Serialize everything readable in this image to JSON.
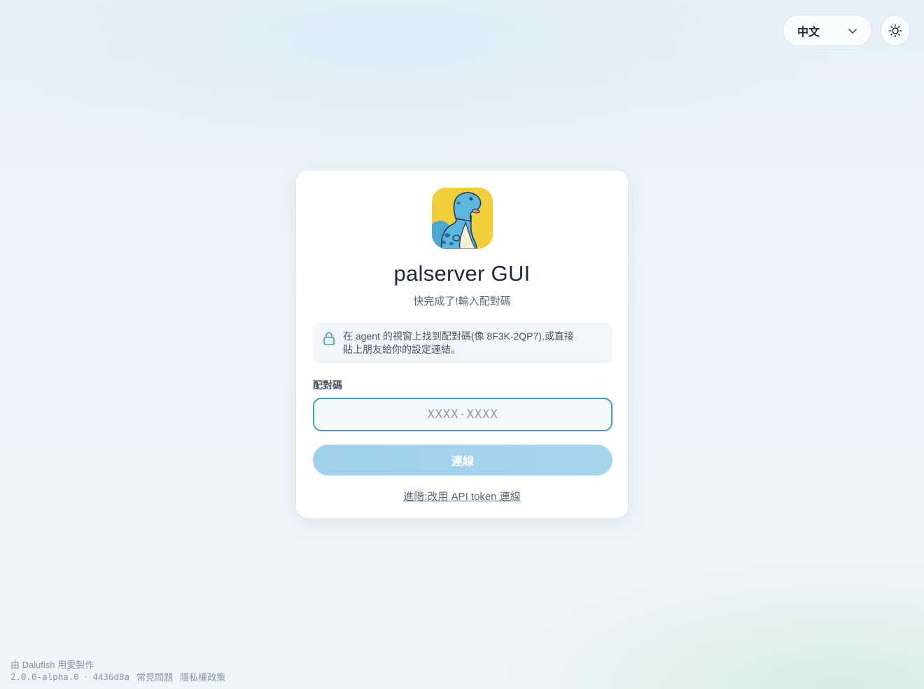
{
  "header": {
    "language": {
      "selected": "中文",
      "icon": "chevron-down-icon"
    },
    "theme_toggle": {
      "icon": "sun-icon"
    }
  },
  "card": {
    "logo_icon": "dinosaur-logo",
    "title": "palserver GUI",
    "subtitle": "快完成了!輸入配對碼",
    "info": {
      "icon": "lock-icon",
      "text_line1": "在 agent 的視窗上找到配對碼(像 8F3K-2QP7),或直接",
      "text_line2": "貼上朋友給你的設定連結。"
    },
    "code_field": {
      "label": "配對碼",
      "placeholder": "XXXX-XXXX",
      "value": ""
    },
    "connect_button_label": "連線",
    "advanced_link": "進階:改用 API token 連線"
  },
  "footer": {
    "credit": "由 Dalufish 用愛製作",
    "version": "2.0.0-alpha.0",
    "separator": "·",
    "commit": "4436d8a",
    "faq_link": "常見問題",
    "privacy_link": "隱私權政策"
  },
  "colors": {
    "accent": "#3d9bd0",
    "button_disabled": "#a2d2ed",
    "logo_background": "#f0cf3a",
    "dino_body": "#5bb8dc"
  }
}
